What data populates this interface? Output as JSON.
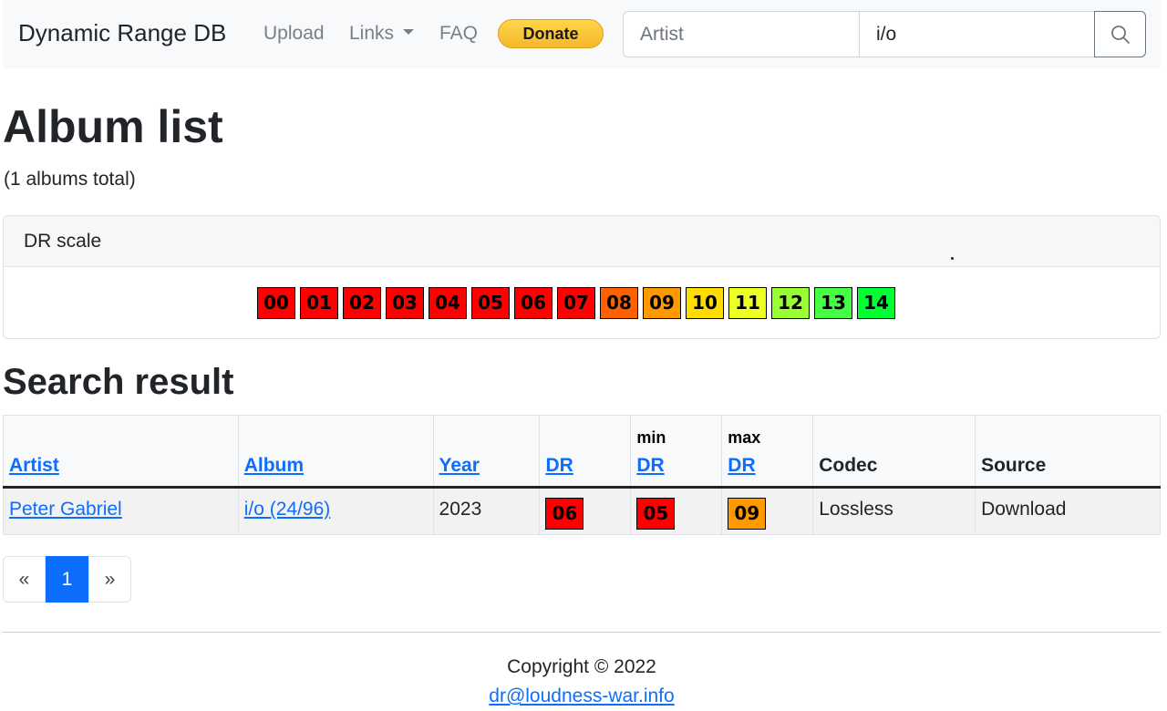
{
  "navbar": {
    "brand": "Dynamic Range DB",
    "upload": "Upload",
    "links": "Links",
    "faq": "FAQ",
    "donate": "Donate",
    "search_type": "Artist",
    "search_value": "i/o"
  },
  "page": {
    "title": "Album list",
    "total": "(1 albums total)"
  },
  "dr_scale": {
    "header": "DR scale",
    "values": [
      "00",
      "01",
      "02",
      "03",
      "04",
      "05",
      "06",
      "07",
      "08",
      "09",
      "10",
      "11",
      "12",
      "13",
      "14"
    ],
    "colors": [
      "#ff0000",
      "#ff0000",
      "#ff0000",
      "#ff0000",
      "#ff0000",
      "#ff0000",
      "#ff0000",
      "#ff0000",
      "#ff6000",
      "#ff9900",
      "#ffdd00",
      "#eeff22",
      "#99ff33",
      "#44ff44",
      "#00ff33"
    ]
  },
  "results": {
    "title": "Search result",
    "headers": {
      "artist": "Artist",
      "album": "Album",
      "year": "Year",
      "dr": "DR",
      "min_pre": "min",
      "min_dr": "DR",
      "max_pre": "max",
      "max_dr": "DR",
      "codec": "Codec",
      "source": "Source"
    },
    "rows": [
      {
        "artist": "Peter Gabriel",
        "album": "i/o (24/96)",
        "year": "2023",
        "dr": "06",
        "dr_color": "#ff0000",
        "min_dr": "05",
        "min_color": "#ff0000",
        "max_dr": "09",
        "max_color": "#ff9900",
        "codec": "Lossless",
        "source": "Download"
      }
    ]
  },
  "pagination": {
    "prev": "«",
    "current": "1",
    "next": "»"
  },
  "footer": {
    "copyright": "Copyright © 2022",
    "email": "dr@loudness-war.info"
  }
}
